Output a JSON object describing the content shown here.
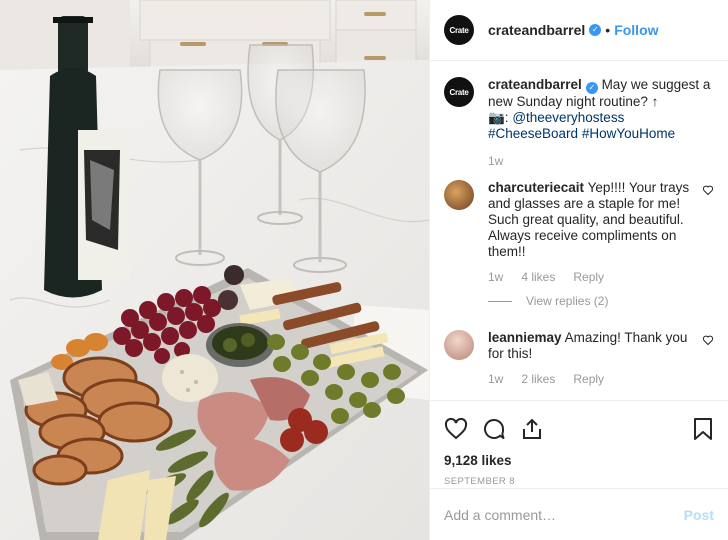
{
  "post": {
    "photo_alt": "",
    "header": {
      "avatar_text": "Crate",
      "username": "crateandbarrel",
      "verified_mark": "✓",
      "separator": "•",
      "follow_label": "Follow",
      "more_label": "···"
    },
    "caption": {
      "avatar_text": "Crate",
      "username": "crateandbarrel",
      "text_line": "May we suggest a new Sunday night routine? ↑",
      "camera_prefix": "📷: ",
      "mention": "@theeveryhostess",
      "tags": [
        "#CheeseBoard",
        "#HowYouHome"
      ],
      "time": "1w"
    },
    "comments": [
      {
        "username": "charcuteriecait",
        "text": "Yep!!!! Your trays and glasses are a staple for me! Such great quality, and beautiful. Always receive compliments on them!!",
        "time": "1w",
        "likes": "4 likes",
        "reply_label": "Reply",
        "view_replies": "View replies (2)",
        "avatar_color": "#8a5a3b"
      },
      {
        "username": "leanniemay",
        "text": "Amazing! Thank you for this!",
        "time": "1w",
        "likes": "2 likes",
        "reply_label": "Reply",
        "avatar_color": "#d9b7a6"
      }
    ],
    "likes_count": "9,128 likes",
    "date": "September 8",
    "add_comment_placeholder": "Add a comment…",
    "post_label": "Post",
    "icons": {
      "like": "heart-icon",
      "comment": "comment-bubble-icon",
      "share": "share-icon",
      "save": "bookmark-icon"
    },
    "colors": {
      "link": "#3897f0",
      "muted": "#999999",
      "text": "#262626"
    }
  }
}
